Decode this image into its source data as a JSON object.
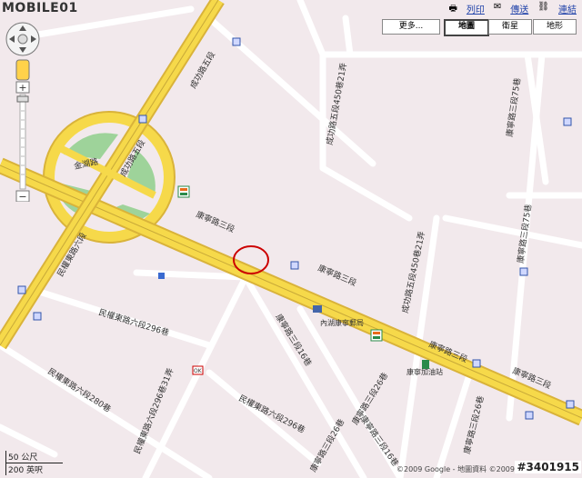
{
  "header": {
    "logo_text": "MOBILE01",
    "print_label": "列印",
    "email_label": "傳送",
    "link_label": "連結"
  },
  "map_types": {
    "more_label": "更多...",
    "map_label": "地圖",
    "satellite_label": "衛星",
    "terrain_label": "地形",
    "selected": "地圖"
  },
  "zoom": {
    "plus": "+",
    "minus": "−"
  },
  "streets": {
    "chenggong_5": "成功路五段",
    "chenggong_5b": "成功路五段",
    "chenggong_450_21": "成功路五段450巷21弄",
    "jinhu": "金湖路",
    "kangning_3a": "康寧路三段",
    "kangning_3b": "康寧路三段",
    "kangning_3c": "康寧路三段",
    "kangning_3d": "康寧路三段",
    "kangning_3_75": "康寧路三段75巷",
    "kangning_3_75b": "康寧路三段75巷",
    "kangning_3_26": "康寧路三段26巷",
    "chenggong_450_21b": "成功路五段450巷21弄",
    "minquan_6": "民權東路六段",
    "minquan_6_296": "民權東路六段296巷",
    "minquan_6_296_31": "民權東路六段296巷31弄",
    "minquan_6_296b": "民權東路六段296巷",
    "minquan_6_280": "民權東路六段280巷",
    "kangle_16": "康寧路三段16巷",
    "kangle_26": "康寧路三段26巷",
    "kangle_16b": "康寧路三段16巷",
    "kangle_26b": "康寧路三段26巷"
  },
  "pois": {
    "post_office": "內湖康寧郵局",
    "gas_station": "康寧加油站",
    "seven_eleven": "7-ELEVEN",
    "ok_mart": "OK"
  },
  "scale": {
    "metric": "50 公尺",
    "imperial": "200 英呎"
  },
  "copyright": "©2009 Google - 地圖資料 ©2009 Kingway",
  "watermark": "#3401915",
  "colors": {
    "highway": "#f6d94a",
    "highway_edge": "#d9b33a",
    "road": "#ffffff",
    "bg": "#f2e9ec",
    "park": "#9ed39a",
    "marker": "#cc0000"
  }
}
